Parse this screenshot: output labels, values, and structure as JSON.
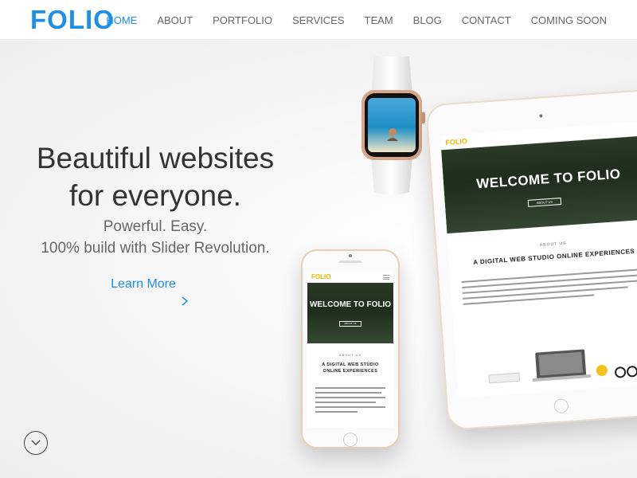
{
  "header": {
    "logo": "FOLIO",
    "nav": [
      {
        "label": "HOME",
        "active": true
      },
      {
        "label": "ABOUT"
      },
      {
        "label": "PORTFOLIO"
      },
      {
        "label": "SERVICES"
      },
      {
        "label": "TEAM"
      },
      {
        "label": "BLOG"
      },
      {
        "label": "CONTACT"
      },
      {
        "label": "COMING SOON"
      }
    ]
  },
  "hero": {
    "headline_line1": "Beautiful websites",
    "headline_line2": "for everyone.",
    "sub_line1": "Powerful. Easy.",
    "sub_line2": "100% build with Slider Revolution.",
    "learn_more": "Learn More"
  },
  "mockups": {
    "tablet": {
      "logo": "FOLIO",
      "title": "WELCOME TO FOLIO",
      "about_label": "ABOUT US",
      "studio_text": "A DIGITAL WEB STUDIO ONLINE EXPERIENCES"
    },
    "phone": {
      "logo": "FOLIO",
      "title": "WELCOME TO FOLIO",
      "about_label": "ABOUT US",
      "studio_line1": "A DIGITAL WEB STUDIO",
      "studio_line2": "ONLINE EXPERIENCES"
    }
  },
  "colors": {
    "brand_blue": "#1e8fe6",
    "mock_logo_yellow": "#f0b400"
  },
  "icons": {
    "learn_more": "chevron-right-icon",
    "scroll": "chevron-down-icon"
  }
}
